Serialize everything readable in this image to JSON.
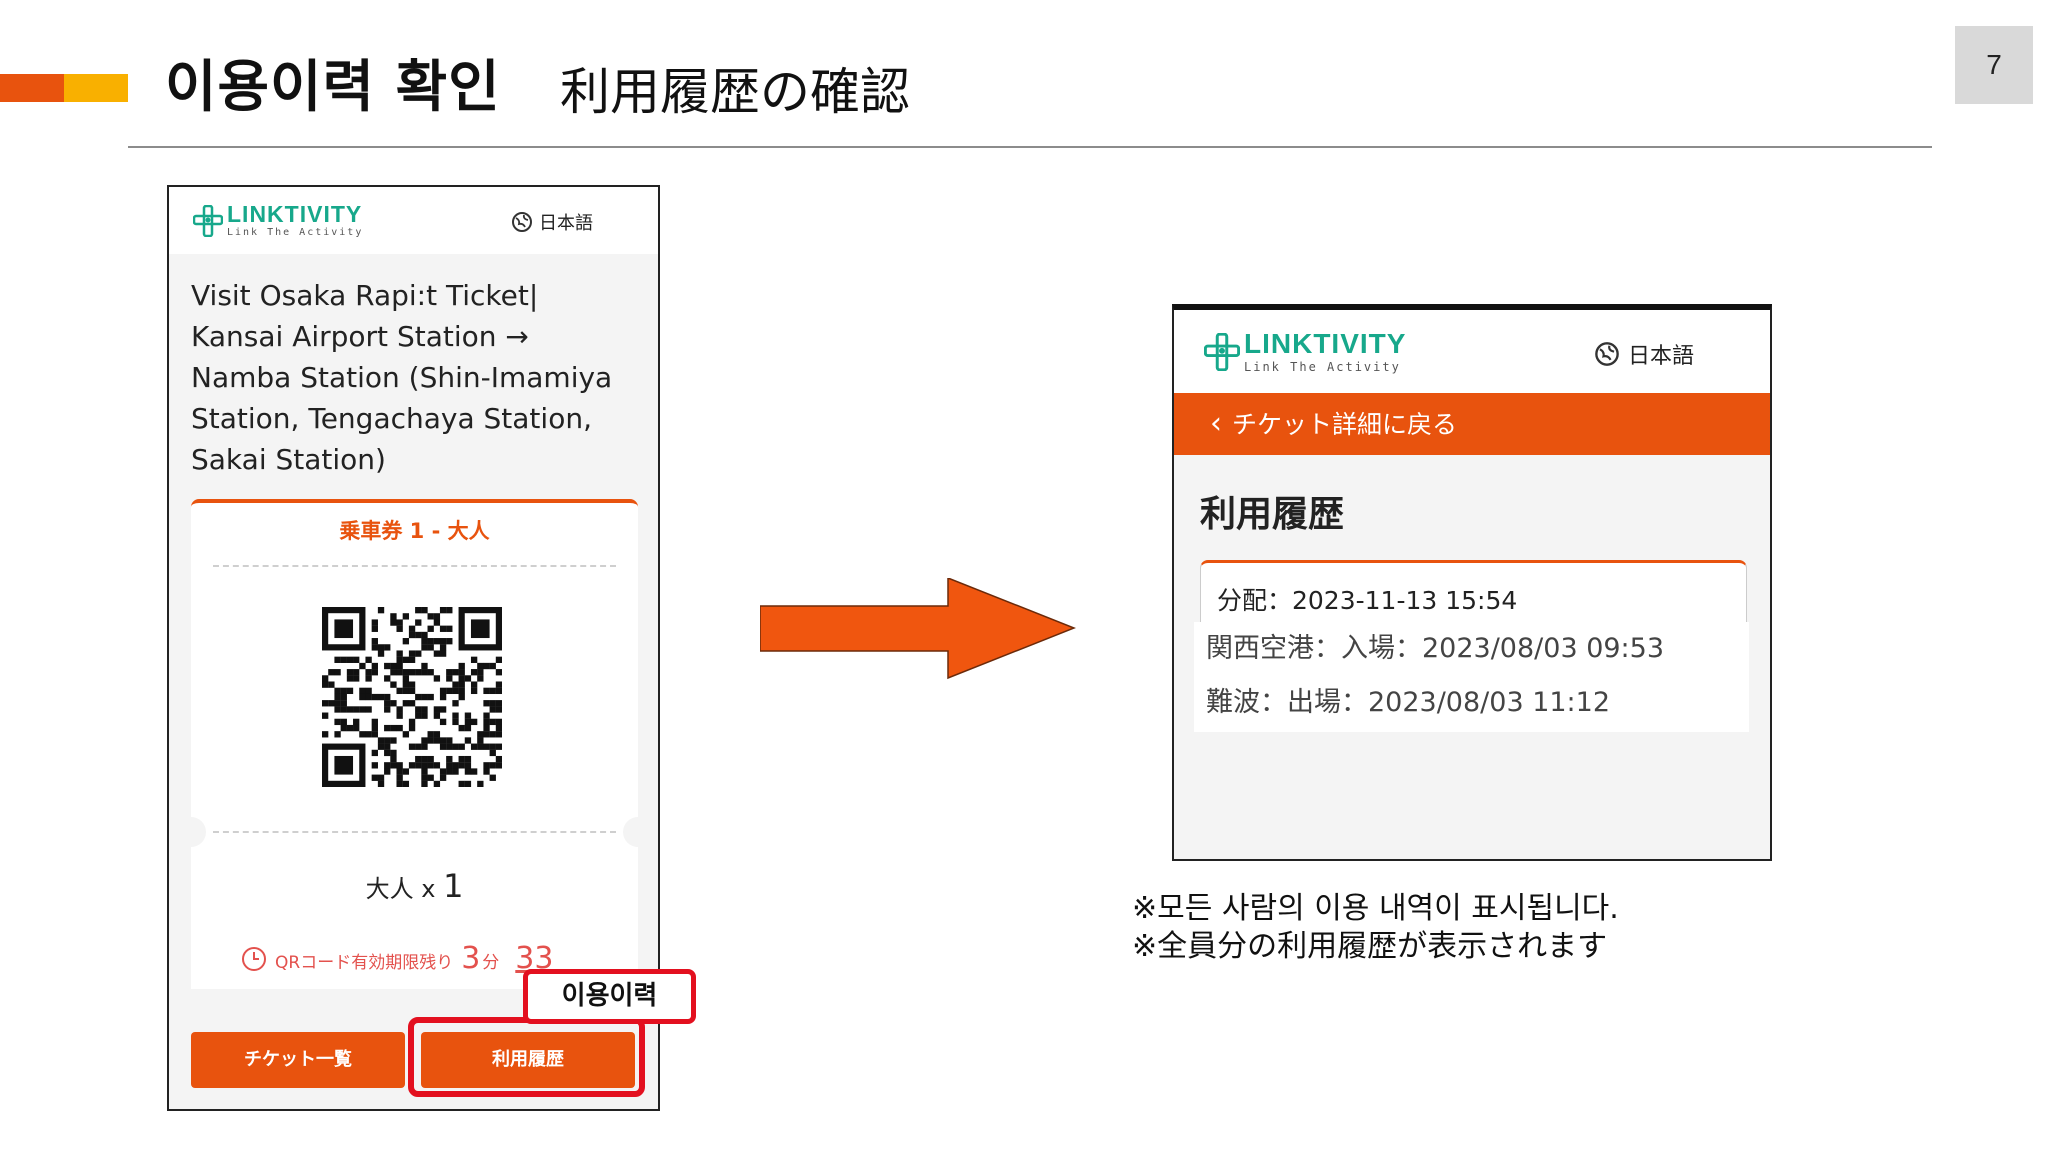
{
  "slide": {
    "title_ko": "이용이력 확인",
    "title_ja": "利用履歴の確認",
    "page_number": "7"
  },
  "brand": {
    "name": "LINKTIVITY",
    "tagline": "Link The Activity",
    "language": "日本語",
    "accent": "#e8530e",
    "logo_color": "#17a88b"
  },
  "left_screen": {
    "product_title": "Visit Osaka Rapi:t Ticket| Kansai Airport Station → Namba Station (Shin-Imamiya Station, Tengachaya Station, Sakai Station)",
    "ticket_type": "乗車券 1 - 大人",
    "quantity_label": "大人 x",
    "quantity_value": "1",
    "qr_timer_label": "QRコード有効期限残り",
    "qr_timer_minutes": "3",
    "qr_timer_minutes_unit": "分",
    "qr_timer_seconds": "33",
    "ticket_list_button": "チケット一覧",
    "history_button": "利用履歴",
    "history_callout": "이용이력"
  },
  "right_screen": {
    "back_label": "チケット詳細に戻る",
    "heading": "利用履歴",
    "allocation": "分配：2023-11-13 15:54",
    "entries": [
      "関西空港：入場：2023/08/03 09:53",
      "難波：出場：2023/08/03 11:12"
    ]
  },
  "notes": {
    "ko": "※모든 사람의 이용 내역이 표시됩니다.",
    "ja": "※全員分の利用履歴が表示されます"
  }
}
